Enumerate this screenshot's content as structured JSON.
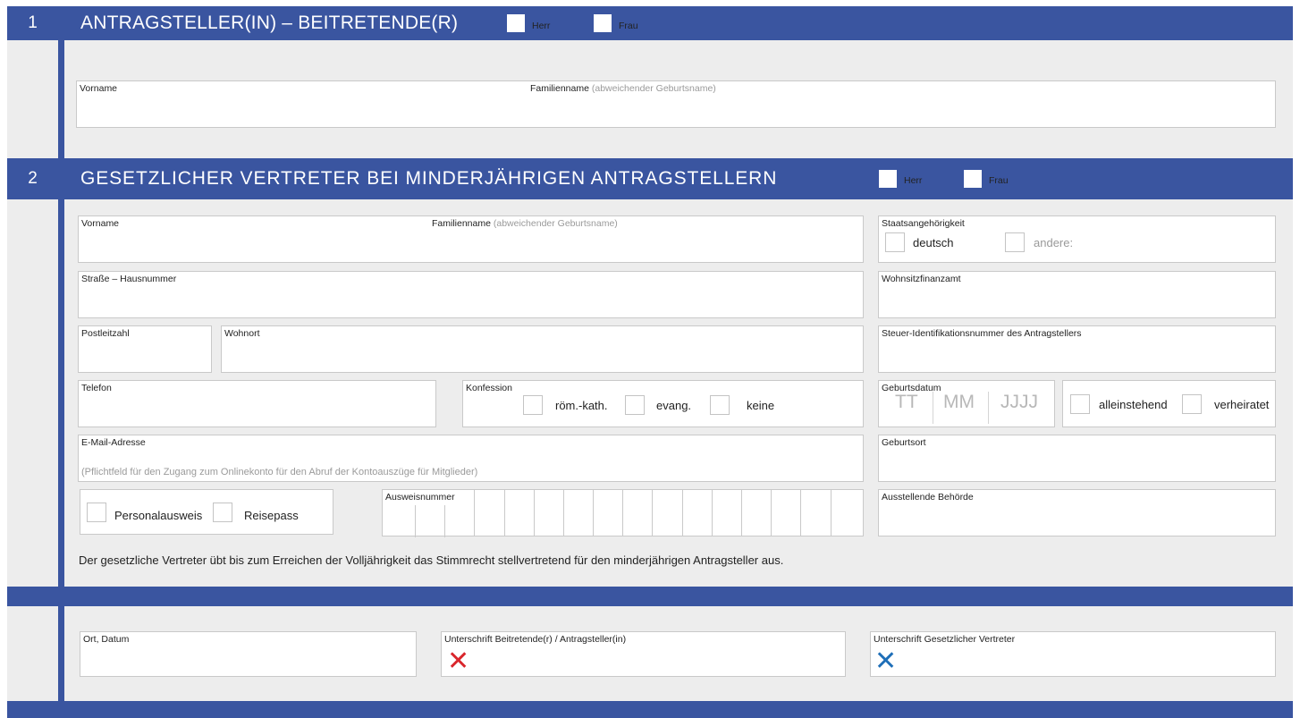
{
  "section1": {
    "number": "1",
    "title": "ANTRAGSTELLER(IN) – BEITRETENDE(R)",
    "herr": "Herr",
    "frau": "Frau",
    "vorname": "Vorname",
    "familienname": "Familienname",
    "familienname_note": "(abweichender Geburtsname)"
  },
  "section2": {
    "number": "2",
    "title": "GESETZLICHER VERTRETER BEI MINDERJÄHRIGEN ANTRAGSTELLERN",
    "herr": "Herr",
    "frau": "Frau",
    "vorname": "Vorname",
    "familienname": "Familienname",
    "familienname_note": "(abweichender Geburtsname)",
    "staatsangehoerigkeit": "Staatsangehörigkeit",
    "deutsch": "deutsch",
    "andere": "andere:",
    "strasse": "Straße – Hausnummer",
    "wohnsitzfinanzamt": "Wohnsitzfinanzamt",
    "postleitzahl": "Postleitzahl",
    "wohnort": "Wohnort",
    "steuer_id": "Steuer-Identifikationsnummer des Antragstellers",
    "telefon": "Telefon",
    "konfession": "Konfession",
    "roem_kath": "röm.-kath.",
    "evang": "evang.",
    "keine": "keine",
    "geburtsdatum": "Geburtsdatum",
    "tt": "TT",
    "mm": "MM",
    "jjjj": "JJJJ",
    "alleinstehend": "alleinstehend",
    "verheiratet": "verheiratet",
    "email": "E-Mail-Adresse",
    "email_note": "(Pflichtfeld für den Zugang zum Onlinekonto für den Abruf der Kontoauszüge für Mitglieder)",
    "geburtsort": "Geburtsort",
    "personalausweis": "Personalausweis",
    "reisepass": "Reisepass",
    "ausweisnummer": "Ausweisnummer",
    "ausstellende_behoerde": "Ausstellende Behörde",
    "statement": "Der gesetzliche Vertreter übt bis zum Erreichen der Volljährigkeit das Stimmrecht stellvertretend für den minderjährigen Antragsteller aus."
  },
  "signatures": {
    "ort_datum": "Ort, Datum",
    "unterschrift_antragsteller": "Unterschrift Beitretende(r) / Antragsteller(in)",
    "unterschrift_vertreter": "Unterschrift Gesetzlicher Vertreter",
    "x_mark": "✕",
    "x_color_antragsteller": "#d9262c",
    "x_color_vertreter": "#1f6fb8"
  },
  "colors": {
    "header_blue": "#3a55a0",
    "background": "#ededed"
  }
}
